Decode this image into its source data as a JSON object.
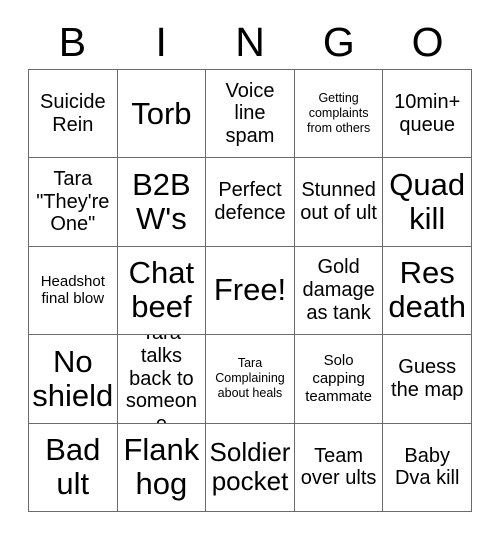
{
  "header": {
    "letters": [
      "B",
      "I",
      "N",
      "G",
      "O"
    ]
  },
  "colors": {
    "background": "#ffffff",
    "grid_line": "#6b6b6b",
    "text": "#000000"
  },
  "grid": {
    "columns": 5,
    "rows": 5,
    "cells": [
      {
        "text": "Suicide Rein",
        "size": "fs-md"
      },
      {
        "text": "Torb",
        "size": "fs-xl"
      },
      {
        "text": "Voice line spam",
        "size": "fs-md"
      },
      {
        "text": "Getting complaints from others",
        "size": "fs-xs"
      },
      {
        "text": "10min+ queue",
        "size": "fs-md"
      },
      {
        "text": "Tara \"They're One\"",
        "size": "fs-md"
      },
      {
        "text": "B2B W's",
        "size": "fs-xl"
      },
      {
        "text": "Perfect defence",
        "size": "fs-md"
      },
      {
        "text": "Stunned out of ult",
        "size": "fs-md"
      },
      {
        "text": "Quad kill",
        "size": "fs-xl"
      },
      {
        "text": "Headshot final blow",
        "size": "fs-sm"
      },
      {
        "text": "Chat beef",
        "size": "fs-xl"
      },
      {
        "text": "Free!",
        "size": "fs-xl"
      },
      {
        "text": "Gold damage as tank",
        "size": "fs-md"
      },
      {
        "text": "Res death",
        "size": "fs-xl"
      },
      {
        "text": "No shield",
        "size": "fs-xl"
      },
      {
        "text": "Tara talks back to someone",
        "size": "fs-md"
      },
      {
        "text": "Tara Complaining about heals",
        "size": "fs-xs"
      },
      {
        "text": "Solo capping teammate",
        "size": "fs-sm"
      },
      {
        "text": "Guess the map",
        "size": "fs-md"
      },
      {
        "text": "Bad ult",
        "size": "fs-xl"
      },
      {
        "text": "Flank hog",
        "size": "fs-xl"
      },
      {
        "text": "Soldier pocket",
        "size": "fs-lg"
      },
      {
        "text": "Team over ults",
        "size": "fs-md"
      },
      {
        "text": "Baby Dva kill",
        "size": "fs-md"
      }
    ]
  }
}
